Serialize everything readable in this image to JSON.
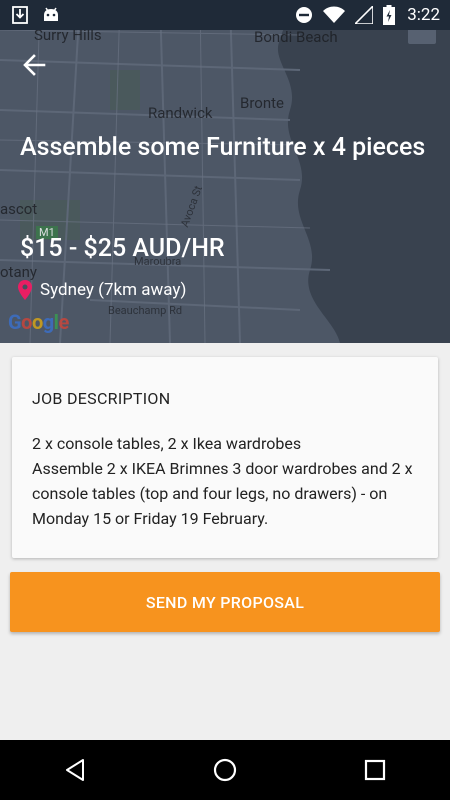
{
  "status_bar": {
    "time": "3:22",
    "icons": [
      "download-icon",
      "android-icon",
      "do-not-disturb-icon",
      "wifi-icon",
      "signal-icon",
      "battery-icon"
    ]
  },
  "map": {
    "labels": [
      "Surry Hills",
      "Bondi Beach",
      "Bronte",
      "Randwick",
      "ascot",
      "otany"
    ],
    "small_labels": [
      "M1",
      "Avoca St",
      "Beauchamp Rd",
      "Maroubra"
    ],
    "attribution": [
      "G",
      "o",
      "o",
      "g",
      "l",
      "e"
    ]
  },
  "job": {
    "title": "Assemble some Furniture x 4 pieces",
    "rate": "$15 - $25 AUD/HR",
    "location": "Sydney (7km away)"
  },
  "description": {
    "heading": "JOB DESCRIPTION",
    "body": "2 x console tables, 2 x Ikea wardrobes\nAssemble 2 x IKEA Brimnes 3 door wardrobes and 2 x console tables (top and four legs, no drawers) - on Monday 15 or Friday 19 February."
  },
  "actions": {
    "send_proposal": "SEND MY PROPOSAL"
  },
  "colors": {
    "accent": "#f7931e",
    "header_overlay": "#46505f",
    "pin": "#e91e63"
  }
}
